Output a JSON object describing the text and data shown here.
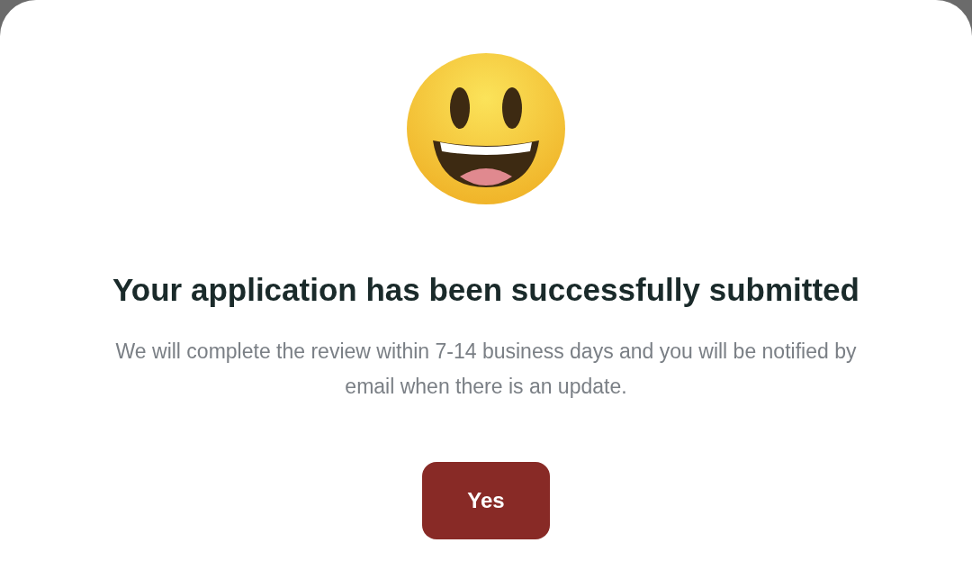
{
  "dialog": {
    "title": "Your application has been successfully submitted",
    "message": "We will complete the review within 7-14 business days and you will be notified by email when there is an update.",
    "buttons": [
      "Yes"
    ]
  }
}
